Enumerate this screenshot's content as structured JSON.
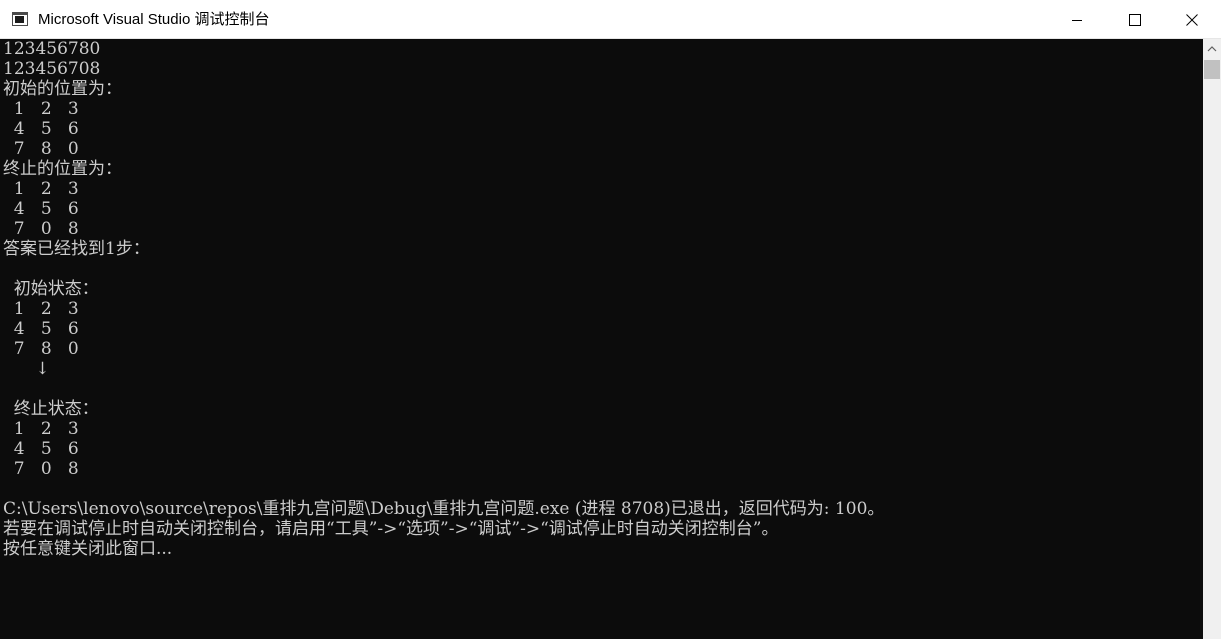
{
  "window": {
    "title": "Microsoft Visual Studio 调试控制台",
    "icons": {
      "app": "console-app-icon",
      "minimize": "minimize-icon",
      "maximize": "maximize-icon",
      "close": "close-icon",
      "scroll_up": "chevron-up-icon"
    }
  },
  "console": {
    "background": "#0c0c0c",
    "foreground": "#cccccc",
    "lines": [
      "123456780",
      "123456708",
      "初始的位置为：",
      "  1   2   3",
      "  4   5   6",
      "  7   8   0",
      "终止的位置为：",
      "  1   2   3",
      "  4   5   6",
      "  7   0   8",
      "答案已经找到1步：",
      "",
      "  初始状态：",
      "  1   2   3",
      "  4   5   6",
      "  7   8   0",
      "      ↓",
      "",
      "  终止状态：",
      "  1   2   3",
      "  4   5   6",
      "  7   0   8",
      "",
      "C:\\Users\\lenovo\\source\\repos\\重排九宫问题\\Debug\\重排九宫问题.exe (进程 8708)已退出，返回代码为: 100。",
      "若要在调试停止时自动关闭控制台，请启用“工具”->“选项”->“调试”->“调试停止时自动关闭控制台”。",
      "按任意键关闭此窗口..."
    ]
  }
}
